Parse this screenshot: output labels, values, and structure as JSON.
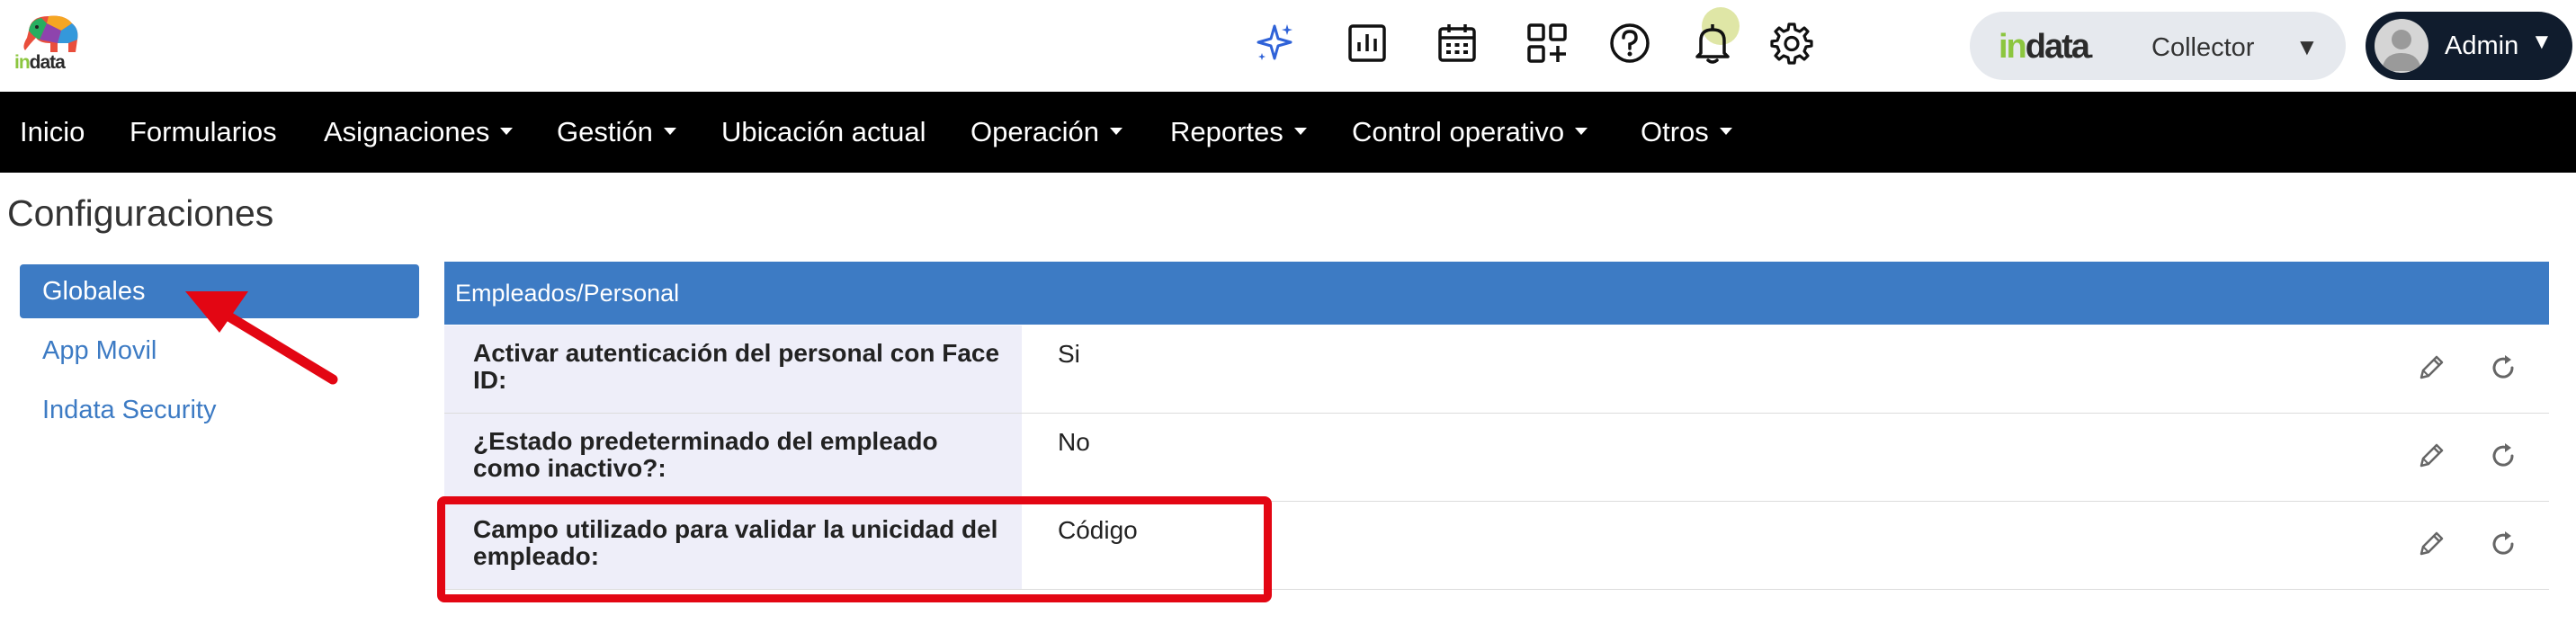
{
  "brand": {
    "logo_in": "in",
    "logo_data": "data",
    "collector_in": "in",
    "collector_data": "data",
    "collector_dot": ".",
    "collector_label": "Collector"
  },
  "header_icons": [
    "sparkle-icon",
    "report-chart-icon",
    "calendar-icon",
    "apps-grid-icon",
    "help-icon",
    "notification-bell-icon",
    "settings-gear-icon"
  ],
  "user": {
    "name": "Admin"
  },
  "nav": [
    {
      "label": "Inicio",
      "dropdown": false
    },
    {
      "label": "Formularios",
      "dropdown": false
    },
    {
      "label": "Asignaciones",
      "dropdown": true
    },
    {
      "label": "Gestión",
      "dropdown": true
    },
    {
      "label": "Ubicación actual",
      "dropdown": false
    },
    {
      "label": "Operación",
      "dropdown": true
    },
    {
      "label": "Reportes",
      "dropdown": true
    },
    {
      "label": "Control operativo",
      "dropdown": true
    },
    {
      "label": "Otros",
      "dropdown": true
    }
  ],
  "page_title": "Configuraciones",
  "sidebar": {
    "items": [
      {
        "label": "Globales",
        "active": true
      },
      {
        "label": "App Movil",
        "active": false
      },
      {
        "label": "Indata Security",
        "active": false
      }
    ]
  },
  "section": {
    "title": "Empleados/Personal",
    "rows": [
      {
        "label": "Activar autenticación del personal con Face ID:",
        "value": "Si"
      },
      {
        "label": "¿Estado predeterminado del empleado como inactivo?:",
        "value": "No"
      },
      {
        "label": "Campo utilizado para validar la unicidad del empleado:",
        "value": "Código"
      }
    ]
  },
  "colors": {
    "primary": "#3d7bc4",
    "nav_bg": "#000000",
    "highlight": "#e30613",
    "brand_green": "#8cc63f",
    "row_label_bg": "#eeeef9"
  }
}
